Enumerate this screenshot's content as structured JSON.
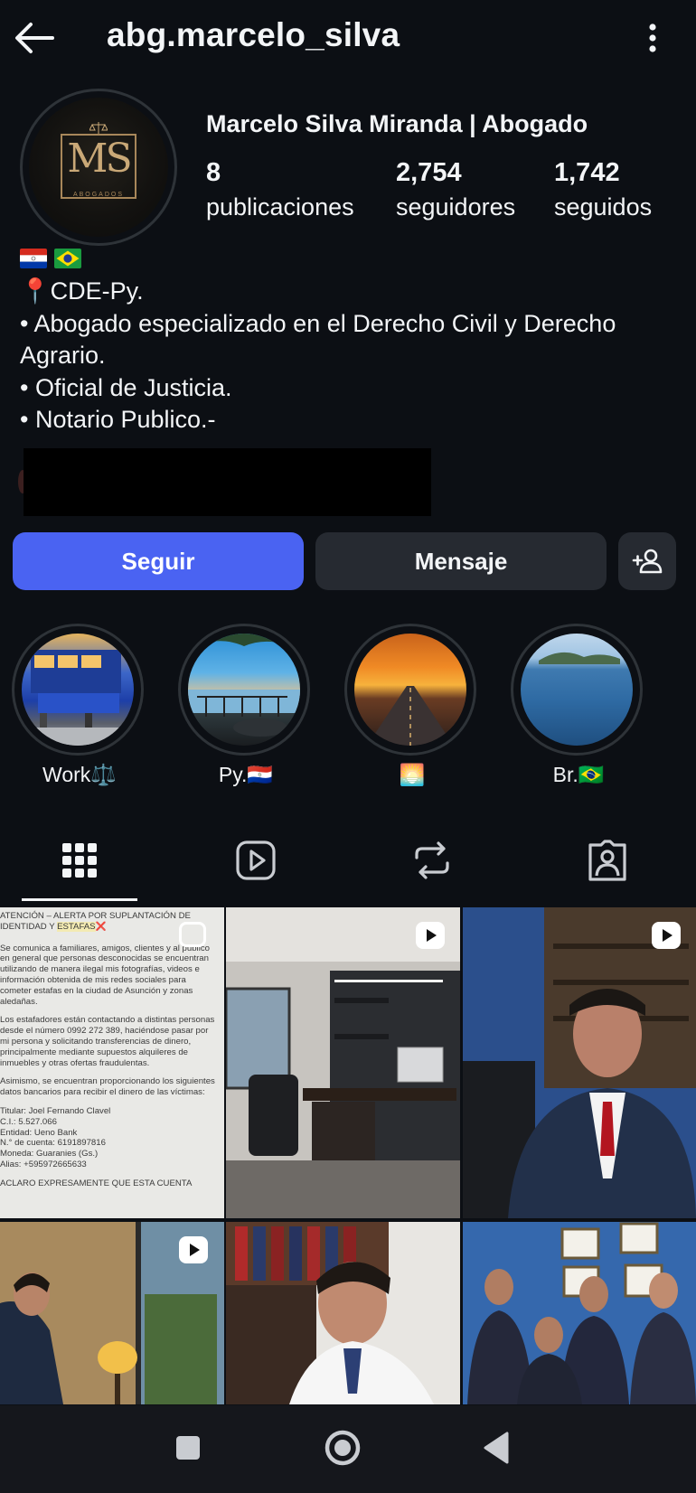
{
  "header": {
    "username": "abg.marcelo_silva",
    "back_icon": "arrow-left-icon",
    "more_icon": "more-vertical-icon"
  },
  "profile": {
    "avatar_logo": "MS",
    "avatar_logo_sub": "ABOGADOS",
    "full_name": "Marcelo Silva Miranda | Abogado",
    "stats": [
      {
        "value": "8",
        "label": "publicaciones"
      },
      {
        "value": "2,754",
        "label": "seguidores"
      },
      {
        "value": "1,742",
        "label": "seguidos"
      }
    ],
    "flags": [
      "paraguay-flag",
      "brazil-flag"
    ],
    "bio_lines": [
      "📍CDE-Py.",
      "• Abogado especializado en el Derecho Civil y Derecho",
      "Agrario.",
      "• Oficial de Justicia.",
      "• Notario Publico.-"
    ]
  },
  "actions": {
    "follow_label": "Seguir",
    "message_label": "Mensaje",
    "add_user_icon": "add-user-icon"
  },
  "highlights": [
    {
      "label": "Work⚖️"
    },
    {
      "label": "Py.🇵🇾"
    },
    {
      "label": "🌅"
    },
    {
      "label": "Br.🇧🇷"
    }
  ],
  "tabs": [
    {
      "name": "grid",
      "icon": "grid-icon",
      "active": true
    },
    {
      "name": "reels",
      "icon": "reels-icon",
      "active": false
    },
    {
      "name": "reposts",
      "icon": "repost-icon",
      "active": false
    },
    {
      "name": "tagged",
      "icon": "tagged-icon",
      "active": false
    }
  ],
  "notice_post": {
    "title_1": "ATENCIÓN – ALERTA POR SUPLANTACIÓN DE",
    "title_2": "IDENTIDAD Y ",
    "title_2_mark": "ESTAFAS",
    "title_2_x": "❌",
    "p1": "Se comunica a familiares, amigos, clientes y al público en general que personas desconocidas se encuentran utilizando de manera ilegal mis fotografías, videos e información obtenida de mis redes sociales para cometer estafas en la ciudad de Asunción y zonas aledañas.",
    "p2": "Los estafadores están contactando a distintas personas desde el número 0992 272 389, haciéndose pasar por mi persona y solicitando transferencias de dinero, principalmente mediante supuestos alquileres de inmuebles y otras ofertas fraudulentas.",
    "p3": "Asimismo, se encuentran proporcionando los siguientes datos bancarios para recibir el dinero de las víctimas:",
    "bank_lines": [
      "Titular: Joel Fernando Clavel",
      "C.I.: 5.527.066",
      "Entidad: Ueno Bank",
      "N.° de cuenta: 6191897816",
      "Moneda: Guaranies (Gs.)",
      "Alias: +595972665633"
    ],
    "p4": "ACLARO EXPRESAMENTE QUE ESTA CUENTA"
  },
  "colors": {
    "background": "#0c0f14",
    "follow_button": "#4a63f2",
    "secondary_button": "#262a31",
    "text": "#f3f5f7"
  },
  "system_nav": {
    "recents_icon": "square-icon",
    "home_icon": "circle-home-icon",
    "back_icon": "triangle-back-icon"
  }
}
